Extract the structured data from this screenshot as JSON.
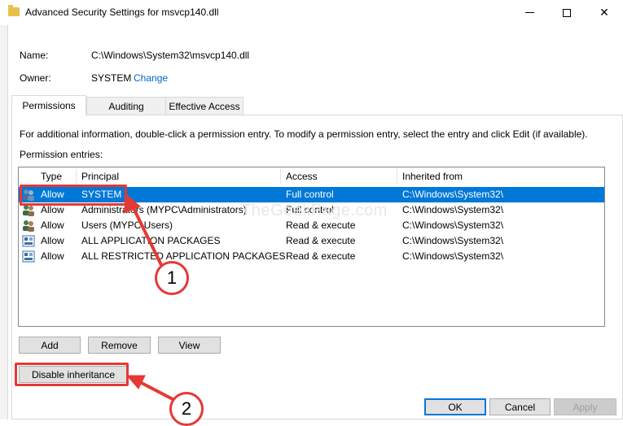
{
  "window": {
    "title": "Advanced Security Settings for msvcp140.dll",
    "minimize_glyph": "",
    "maximize_glyph": "",
    "close_glyph": "✕"
  },
  "file": {
    "name_label": "Name:",
    "name_value": "C:\\Windows\\System32\\msvcp140.dll",
    "owner_label": "Owner:",
    "owner_value": "SYSTEM",
    "change_link": "Change"
  },
  "tabs": [
    {
      "label": "Permissions",
      "selected": true
    },
    {
      "label": "Auditing",
      "selected": false
    },
    {
      "label": "Effective Access",
      "selected": false
    }
  ],
  "permissions": {
    "info_text": "For additional information, double-click a permission entry. To modify a permission entry, select the entry and click Edit (if available).",
    "entries_label": "Permission entries:",
    "columns": [
      "Type",
      "Principal",
      "Access",
      "Inherited from"
    ],
    "rows": [
      {
        "icon": "users-icon",
        "type": "Allow",
        "principal": "SYSTEM",
        "access": "Full control",
        "inherited_from": "C:\\Windows\\System32\\",
        "selected": true
      },
      {
        "icon": "users-icon",
        "type": "Allow",
        "principal": "Administrators (MYPC\\Administrators)",
        "access": "Full control",
        "inherited_from": "C:\\Windows\\System32\\",
        "selected": false
      },
      {
        "icon": "users-icon",
        "type": "Allow",
        "principal": "Users (MYPC\\Users)",
        "access": "Read & execute",
        "inherited_from": "C:\\Windows\\System32\\",
        "selected": false
      },
      {
        "icon": "package-icon",
        "type": "Allow",
        "principal": "ALL APPLICATION PACKAGES",
        "access": "Read & execute",
        "inherited_from": "C:\\Windows\\System32\\",
        "selected": false
      },
      {
        "icon": "package-icon",
        "type": "Allow",
        "principal": "ALL RESTRICTED APPLICATION PACKAGES",
        "access": "Read & execute",
        "inherited_from": "C:\\Windows\\System32\\",
        "selected": false
      }
    ]
  },
  "buttons": {
    "add": "Add",
    "remove": "Remove",
    "view": "View",
    "disable_inheritance": "Disable inheritance",
    "ok": "OK",
    "cancel": "Cancel",
    "apply": "Apply"
  },
  "annotations": {
    "callout_1": "1",
    "callout_2": "2",
    "color": "#e53935",
    "watermark": "TheGeekPage.com"
  },
  "colors": {
    "selection": "#0078d7",
    "link": "#0066cc"
  }
}
